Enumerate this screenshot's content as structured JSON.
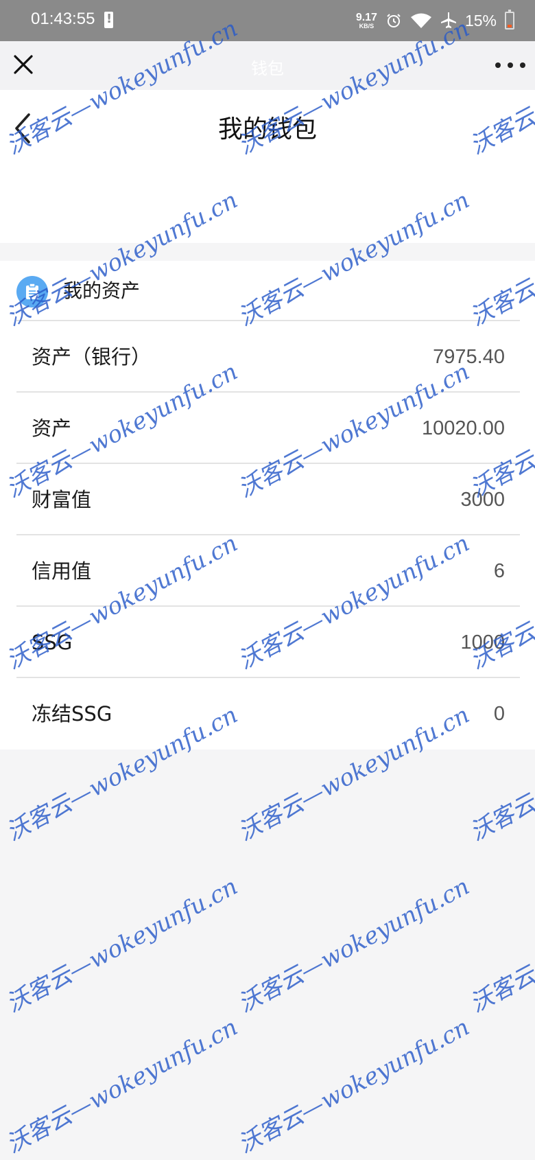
{
  "status_bar": {
    "time": "01:43:55",
    "net_speed": "9.17",
    "net_speed_unit": "KB/S",
    "battery_percent": "15%",
    "icons": [
      "battery-alert-icon",
      "alarm-icon",
      "wifi-icon",
      "airplane-icon",
      "battery-icon"
    ]
  },
  "wechat_bar": {
    "title": "钱包",
    "close_icon": "close-icon",
    "more_icon": "more-icon"
  },
  "header": {
    "title": "我的钱包",
    "back_icon": "back-icon"
  },
  "assets": {
    "title": "我的资产",
    "icon": "clipboard-icon",
    "rows": [
      {
        "label": "资产（银行）",
        "value": "7975.40"
      },
      {
        "label": "资产",
        "value": "10020.00"
      },
      {
        "label": "财富值",
        "value": "3000"
      },
      {
        "label": "信用值",
        "value": "6"
      },
      {
        "label": "SSG",
        "value": "1000"
      },
      {
        "label": "冻结SSG",
        "value": "0"
      }
    ]
  },
  "watermark": {
    "text": "沃客云—wokeyunfu.cn"
  },
  "colors": {
    "status_bar_bg": "#8a8a8a",
    "accent_icon": "#5aaaf2",
    "watermark": "#285ac8",
    "page_bg": "#f5f5f6"
  }
}
